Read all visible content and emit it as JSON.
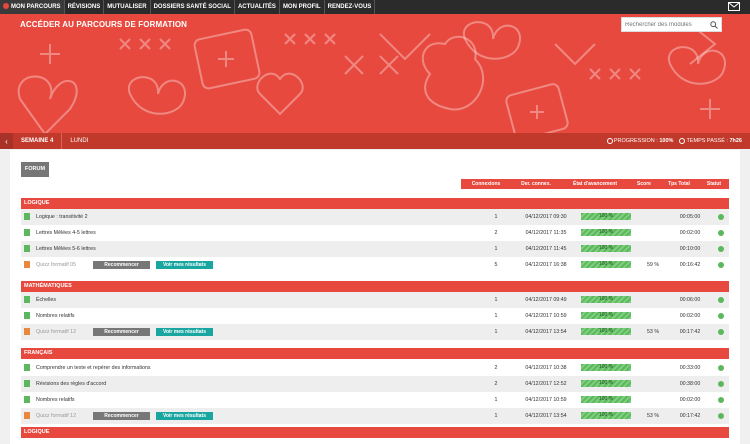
{
  "nav": {
    "items": [
      "MON PARCOURS",
      "RÉVISIONS",
      "MUTUALISER",
      "DOSSIERS SANTÉ SOCIAL",
      "ACTUALITÉS",
      "MON PROFIL",
      "RENDEZ-VOUS"
    ],
    "active_index": 0
  },
  "banner": {
    "title": "ACCÉDER AU PARCOURS DE FORMATION",
    "search_placeholder": "Rechercher des modules",
    "bg_color": "#e8493f"
  },
  "week": {
    "semaine": "SEMAINE 4",
    "day": "LUNDI",
    "progression_label": "PROGRESSION :",
    "progression_value": "100%",
    "temps_label": "TEMPS PASSÉ :",
    "temps_value": "7h26"
  },
  "forum_label": "FORUM",
  "table_headers": {
    "connexions": "Connexions",
    "der_connex": "Der. connex.",
    "etat": "État d'avancement",
    "score": "Score",
    "tps_total": "Tps Total",
    "statut": "Statut"
  },
  "buttons": {
    "recommencer": "Recommencer",
    "resultats": "Voir mes résultats"
  },
  "sections": [
    {
      "title": "LOGIQUE",
      "rows": [
        {
          "type": "doc",
          "label": "Logique : transitivité 2",
          "connexions": "1",
          "date": "04/12/2017 09:30",
          "progress": "100 %",
          "score": "",
          "time": "00:05:00"
        },
        {
          "type": "doc",
          "label": "Lettres Mêlées 4-5 lettres",
          "connexions": "2",
          "date": "04/12/2017 11:35",
          "progress": "100 %",
          "score": "",
          "time": "00:02:00"
        },
        {
          "type": "doc",
          "label": "Lettres Mêlées 5-6 lettres",
          "connexions": "1",
          "date": "04/12/2017 11:45",
          "progress": "100 %",
          "score": "",
          "time": "00:10:00"
        },
        {
          "type": "quiz",
          "label": "Quizz formatif 05",
          "connexions": "5",
          "date": "04/12/2017 16:38",
          "progress": "100 %",
          "score": "59 %",
          "time": "00:16:42"
        }
      ]
    },
    {
      "title": "MATHÉMATIQUES",
      "rows": [
        {
          "type": "doc",
          "label": "Échelles",
          "connexions": "1",
          "date": "04/12/2017 09:49",
          "progress": "100 %",
          "score": "",
          "time": "00:06:00"
        },
        {
          "type": "doc",
          "label": "Nombres relatifs",
          "connexions": "1",
          "date": "04/12/2017 10:59",
          "progress": "100 %",
          "score": "",
          "time": "00:02:00"
        },
        {
          "type": "quiz",
          "label": "Quizz formatif 12",
          "connexions": "1",
          "date": "04/12/2017 13:54",
          "progress": "100 %",
          "score": "53 %",
          "time": "00:17:42"
        }
      ]
    },
    {
      "title": "FRANÇAIS",
      "rows": [
        {
          "type": "doc",
          "label": "Comprendre un texte et repérer des informations",
          "connexions": "2",
          "date": "04/12/2017 10:38",
          "progress": "100 %",
          "score": "",
          "time": "00:33:00"
        },
        {
          "type": "doc",
          "label": "Révisions des règles d'accord",
          "connexions": "2",
          "date": "04/12/2017 12:52",
          "progress": "100 %",
          "score": "",
          "time": "00:38:00"
        },
        {
          "type": "doc",
          "label": "Nombres relatifs",
          "connexions": "1",
          "date": "04/12/2017 10:59",
          "progress": "100 %",
          "score": "",
          "time": "00:02:00"
        },
        {
          "type": "quiz",
          "label": "Quizz formatif 12",
          "connexions": "1",
          "date": "04/12/2017 13:54",
          "progress": "100 %",
          "score": "53 %",
          "time": "00:17:42"
        }
      ]
    },
    {
      "title": "LOGIQUE",
      "rows": []
    }
  ]
}
